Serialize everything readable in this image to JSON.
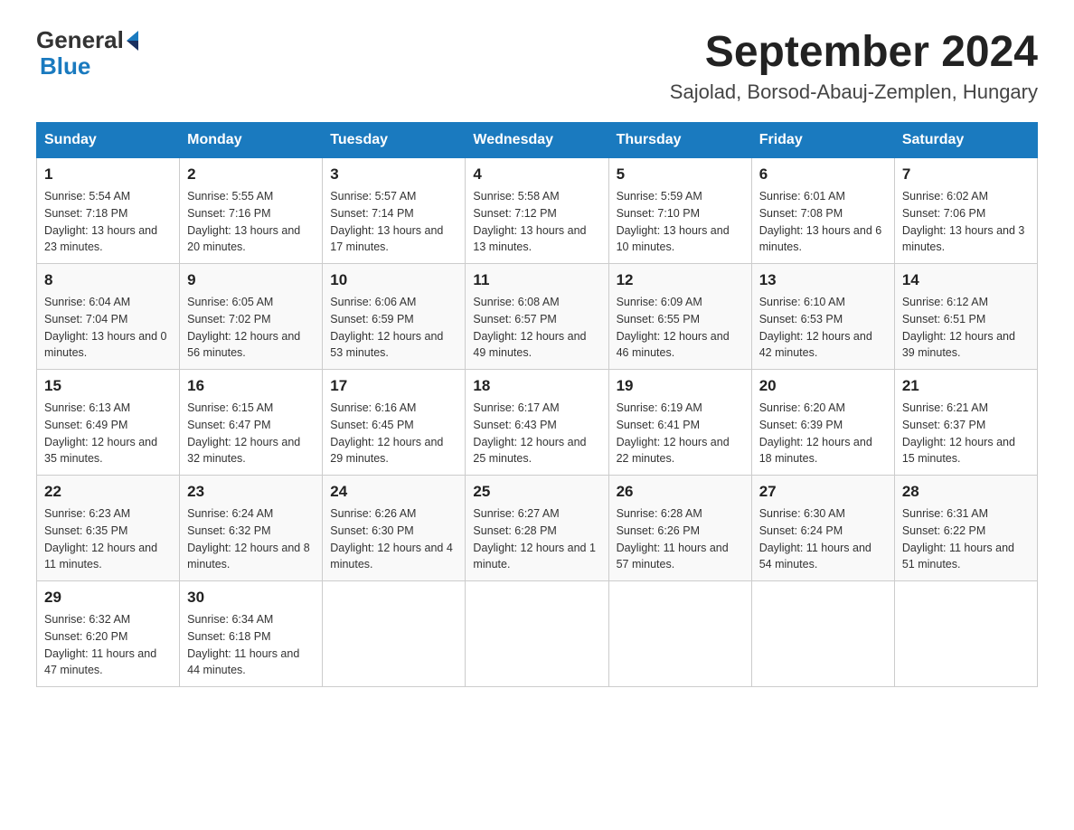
{
  "header": {
    "logo_general": "General",
    "logo_blue": "Blue",
    "month_year": "September 2024",
    "location": "Sajolad, Borsod-Abauj-Zemplen, Hungary"
  },
  "weekdays": [
    "Sunday",
    "Monday",
    "Tuesday",
    "Wednesday",
    "Thursday",
    "Friday",
    "Saturday"
  ],
  "weeks": [
    [
      {
        "day": "1",
        "sunrise": "5:54 AM",
        "sunset": "7:18 PM",
        "daylight": "13 hours and 23 minutes."
      },
      {
        "day": "2",
        "sunrise": "5:55 AM",
        "sunset": "7:16 PM",
        "daylight": "13 hours and 20 minutes."
      },
      {
        "day": "3",
        "sunrise": "5:57 AM",
        "sunset": "7:14 PM",
        "daylight": "13 hours and 17 minutes."
      },
      {
        "day": "4",
        "sunrise": "5:58 AM",
        "sunset": "7:12 PM",
        "daylight": "13 hours and 13 minutes."
      },
      {
        "day": "5",
        "sunrise": "5:59 AM",
        "sunset": "7:10 PM",
        "daylight": "13 hours and 10 minutes."
      },
      {
        "day": "6",
        "sunrise": "6:01 AM",
        "sunset": "7:08 PM",
        "daylight": "13 hours and 6 minutes."
      },
      {
        "day": "7",
        "sunrise": "6:02 AM",
        "sunset": "7:06 PM",
        "daylight": "13 hours and 3 minutes."
      }
    ],
    [
      {
        "day": "8",
        "sunrise": "6:04 AM",
        "sunset": "7:04 PM",
        "daylight": "13 hours and 0 minutes."
      },
      {
        "day": "9",
        "sunrise": "6:05 AM",
        "sunset": "7:02 PM",
        "daylight": "12 hours and 56 minutes."
      },
      {
        "day": "10",
        "sunrise": "6:06 AM",
        "sunset": "6:59 PM",
        "daylight": "12 hours and 53 minutes."
      },
      {
        "day": "11",
        "sunrise": "6:08 AM",
        "sunset": "6:57 PM",
        "daylight": "12 hours and 49 minutes."
      },
      {
        "day": "12",
        "sunrise": "6:09 AM",
        "sunset": "6:55 PM",
        "daylight": "12 hours and 46 minutes."
      },
      {
        "day": "13",
        "sunrise": "6:10 AM",
        "sunset": "6:53 PM",
        "daylight": "12 hours and 42 minutes."
      },
      {
        "day": "14",
        "sunrise": "6:12 AM",
        "sunset": "6:51 PM",
        "daylight": "12 hours and 39 minutes."
      }
    ],
    [
      {
        "day": "15",
        "sunrise": "6:13 AM",
        "sunset": "6:49 PM",
        "daylight": "12 hours and 35 minutes."
      },
      {
        "day": "16",
        "sunrise": "6:15 AM",
        "sunset": "6:47 PM",
        "daylight": "12 hours and 32 minutes."
      },
      {
        "day": "17",
        "sunrise": "6:16 AM",
        "sunset": "6:45 PM",
        "daylight": "12 hours and 29 minutes."
      },
      {
        "day": "18",
        "sunrise": "6:17 AM",
        "sunset": "6:43 PM",
        "daylight": "12 hours and 25 minutes."
      },
      {
        "day": "19",
        "sunrise": "6:19 AM",
        "sunset": "6:41 PM",
        "daylight": "12 hours and 22 minutes."
      },
      {
        "day": "20",
        "sunrise": "6:20 AM",
        "sunset": "6:39 PM",
        "daylight": "12 hours and 18 minutes."
      },
      {
        "day": "21",
        "sunrise": "6:21 AM",
        "sunset": "6:37 PM",
        "daylight": "12 hours and 15 minutes."
      }
    ],
    [
      {
        "day": "22",
        "sunrise": "6:23 AM",
        "sunset": "6:35 PM",
        "daylight": "12 hours and 11 minutes."
      },
      {
        "day": "23",
        "sunrise": "6:24 AM",
        "sunset": "6:32 PM",
        "daylight": "12 hours and 8 minutes."
      },
      {
        "day": "24",
        "sunrise": "6:26 AM",
        "sunset": "6:30 PM",
        "daylight": "12 hours and 4 minutes."
      },
      {
        "day": "25",
        "sunrise": "6:27 AM",
        "sunset": "6:28 PM",
        "daylight": "12 hours and 1 minute."
      },
      {
        "day": "26",
        "sunrise": "6:28 AM",
        "sunset": "6:26 PM",
        "daylight": "11 hours and 57 minutes."
      },
      {
        "day": "27",
        "sunrise": "6:30 AM",
        "sunset": "6:24 PM",
        "daylight": "11 hours and 54 minutes."
      },
      {
        "day": "28",
        "sunrise": "6:31 AM",
        "sunset": "6:22 PM",
        "daylight": "11 hours and 51 minutes."
      }
    ],
    [
      {
        "day": "29",
        "sunrise": "6:32 AM",
        "sunset": "6:20 PM",
        "daylight": "11 hours and 47 minutes."
      },
      {
        "day": "30",
        "sunrise": "6:34 AM",
        "sunset": "6:18 PM",
        "daylight": "11 hours and 44 minutes."
      },
      null,
      null,
      null,
      null,
      null
    ]
  ]
}
